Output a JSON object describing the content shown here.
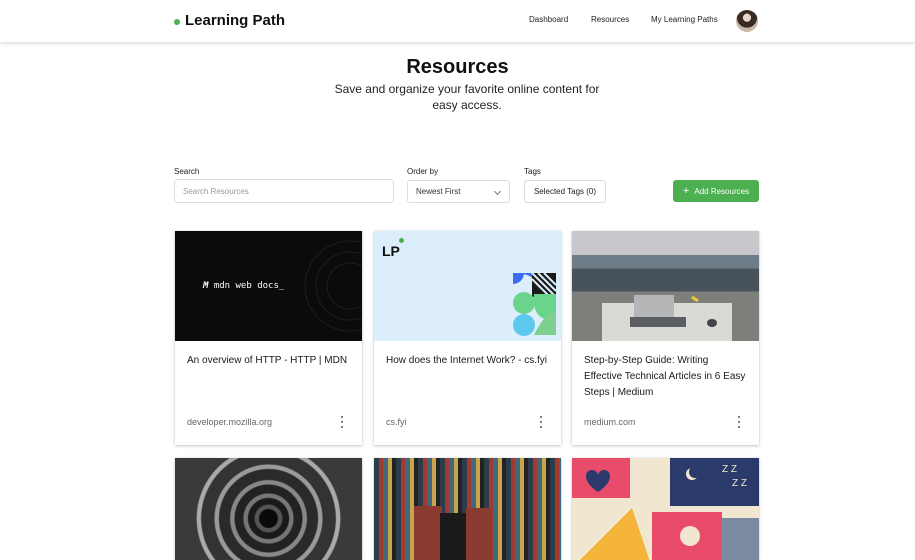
{
  "header": {
    "brand": "Learning Path",
    "nav": [
      "Dashboard",
      "Resources",
      "My Learning Paths"
    ]
  },
  "hero": {
    "title": "Resources",
    "subtitle": "Save and organize your favorite online content for easy access."
  },
  "filters": {
    "search_label": "Search",
    "search_placeholder": "Search Resources",
    "order_label": "Order by",
    "order_value": "Newest First",
    "tags_label": "Tags",
    "tags_button": "Selected Tags (0)",
    "add_button": "Add Resources"
  },
  "cards": [
    {
      "title": "An overview of HTTP - HTTP | MDN",
      "domain": "developer.mozilla.org",
      "thumb_text": "mdn web docs_"
    },
    {
      "title": "How does the Internet Work? - cs.fyi",
      "domain": "cs.fyi",
      "thumb_text": "LP"
    },
    {
      "title": "Step-by-Step Guide: Writing Effective Technical Articles in 6 Easy Steps | Medium",
      "domain": "medium.com"
    },
    {
      "title": "",
      "domain": ""
    },
    {
      "title": "",
      "domain": ""
    },
    {
      "title": "",
      "domain": ""
    }
  ],
  "colors": {
    "accent": "#4caf50"
  },
  "icons": {
    "add": "plus-icon",
    "menu": "more-vertical-icon",
    "dropdown": "chevron-down-icon"
  }
}
